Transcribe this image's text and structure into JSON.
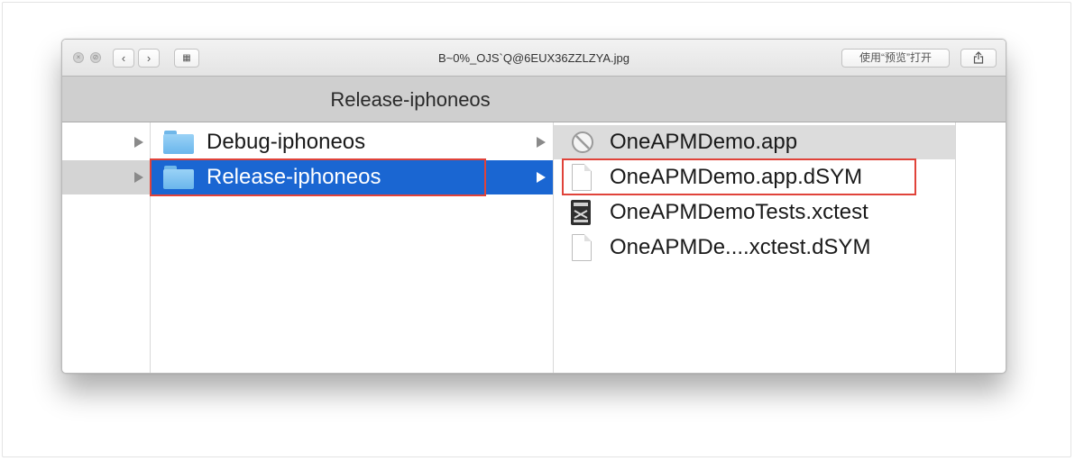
{
  "window": {
    "title": "B~0%_OJS`Q@6EUX36ZZLZYA.jpg",
    "open_with_button": "使用“预览”打开"
  },
  "pathbar": {
    "title": "Release-iphoneos"
  },
  "column1": {
    "items": [
      {
        "label": "Debug-iphoneos",
        "icon": "folder-icon",
        "selected": false
      },
      {
        "label": "Release-iphoneos",
        "icon": "folder-icon",
        "selected": true
      }
    ]
  },
  "column2": {
    "items": [
      {
        "label": "OneAPMDemo.app",
        "icon": "app-icon",
        "highlighted": true
      },
      {
        "label": "OneAPMDemo.app.dSYM",
        "icon": "document-icon",
        "highlighted": false
      },
      {
        "label": "OneAPMDemoTests.xctest",
        "icon": "xctest-bundle-icon",
        "highlighted": false
      },
      {
        "label": "OneAPMDe....xctest.dSYM",
        "icon": "document-icon",
        "highlighted": false
      }
    ]
  },
  "colors": {
    "selection": "#1a66d2",
    "annotation_red": "#e0433a",
    "folder_blue": "#6ab6ec"
  }
}
